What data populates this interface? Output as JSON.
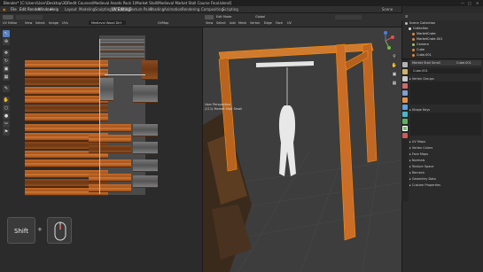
{
  "window_title": "Blender* [C:\\Users\\User\\Desktop\\3DRedit Courses\\Medieval Assets Pack 1\\Market Stall\\Medieval Market Stall Course Final.blend]",
  "menu": [
    "File",
    "Edit",
    "Render",
    "Window",
    "Help"
  ],
  "workspaces": [
    "Layout",
    "Modeling",
    "Sculpting",
    "UV Editing",
    "Texture Paint",
    "Shading",
    "Animation",
    "Rendering",
    "Compositing",
    "Scripting"
  ],
  "active_workspace": "UV Editing",
  "scene_label": "Scene",
  "view_layer_label": "View Layer",
  "uv_editor": {
    "mode": "UV Editor",
    "menus": [
      "View",
      "Select",
      "Image",
      "UVs"
    ],
    "image_name": "Medieval Wood Dirt",
    "uvmap": "UVMap"
  },
  "viewport": {
    "mode": "Edit Mode",
    "menus": [
      "View",
      "Select",
      "Add",
      "Mesh",
      "Vertex",
      "Edge",
      "Face",
      "UV"
    ],
    "transform": "Global",
    "info_line1": "User Perspective",
    "info_line2": "(111) Market Stall Small"
  },
  "keys": {
    "shift": "Shift",
    "plus": "+"
  },
  "outliner": {
    "title": "Scene Collection",
    "items": [
      "Collection",
      "MarketCrate",
      "MarketCrate.001",
      "Camera",
      "Cube",
      "Cube.001"
    ]
  },
  "properties": {
    "object_name": "Market Stall Small",
    "mesh_name": "Cube.001",
    "data_label": "Cube.001",
    "sections_top": [
      "Vertex Groups",
      "Shape Keys"
    ],
    "sections": [
      "UV Maps",
      "Vertex Colors",
      "Face Maps",
      "Normals",
      "Texture Space",
      "Remesh",
      "Geometry Data",
      "Custom Properties"
    ]
  },
  "colors": {
    "accent": "#5680c2",
    "wood": "#c46d2b",
    "selection": "#ff8f00"
  }
}
